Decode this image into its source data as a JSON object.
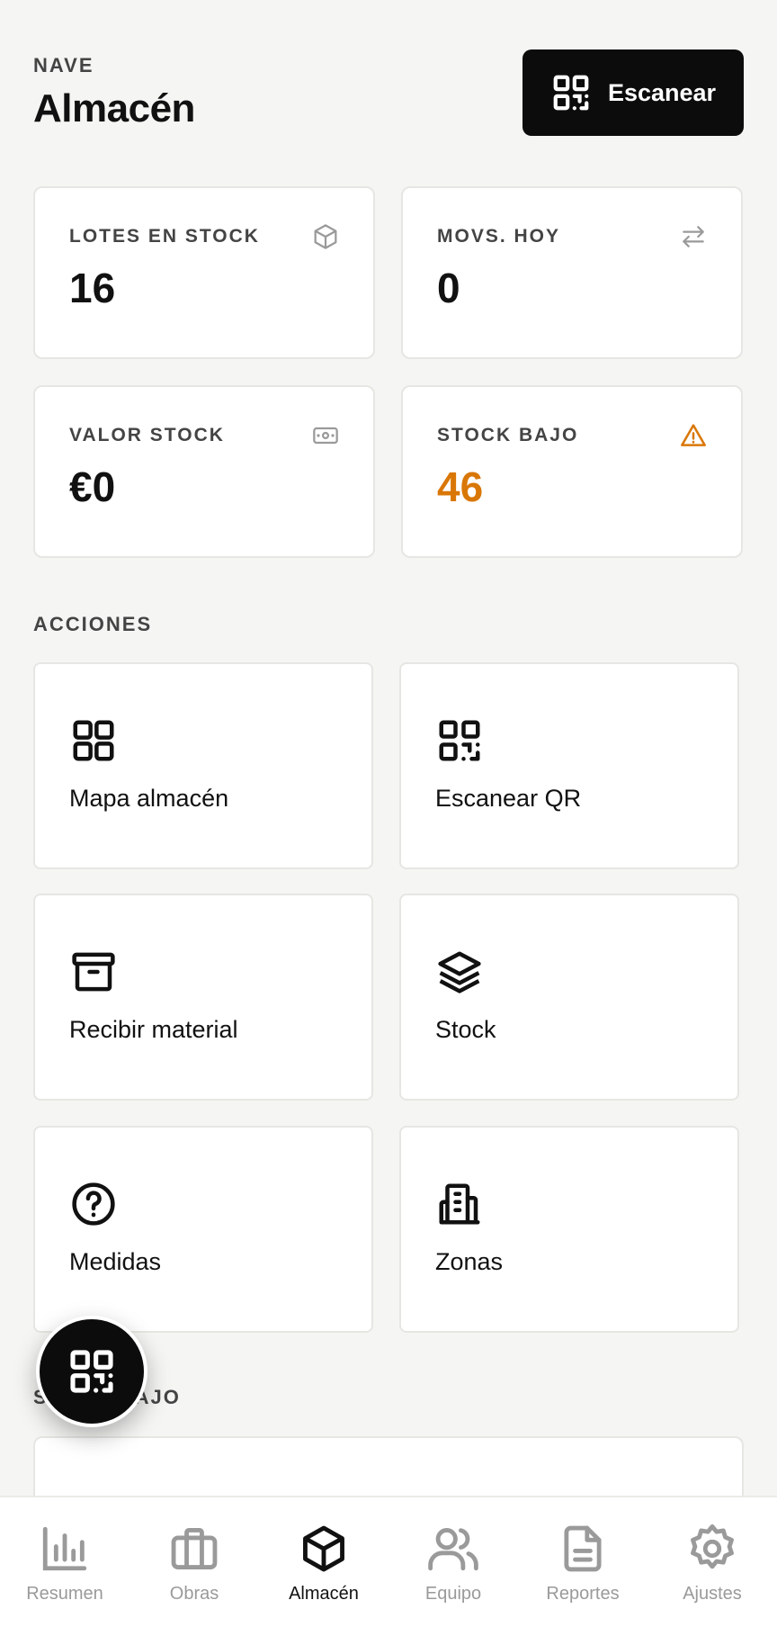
{
  "header": {
    "eyebrow": "NAVE",
    "title": "Almacén",
    "scan_label": "Escanear"
  },
  "stats": [
    {
      "label": "LOTES EN STOCK",
      "value": "16",
      "icon": "cube-icon"
    },
    {
      "label": "MOVS. HOY",
      "value": "0",
      "icon": "arrows-swap-icon"
    },
    {
      "label": "VALOR STOCK",
      "value": "€0",
      "icon": "banknote-icon"
    },
    {
      "label": "STOCK BAJO",
      "value": "46",
      "icon": "warning-triangle-icon",
      "color": "#d97706"
    }
  ],
  "actions_section": {
    "label": "ACCIONES"
  },
  "actions": [
    {
      "label": "Mapa almacén",
      "icon": "grid-icon"
    },
    {
      "label": "Escanear QR",
      "icon": "qr-icon"
    },
    {
      "label": "Recibir material",
      "icon": "archive-box-icon"
    },
    {
      "label": "Stock",
      "icon": "layers-icon"
    },
    {
      "label": "Medidas",
      "icon": "help-circle-icon"
    },
    {
      "label": "Zonas",
      "icon": "building-icon"
    }
  ],
  "low_stock_section": {
    "label": "STOCK BAJO"
  },
  "tabs": [
    {
      "label": "Resumen",
      "icon": "bar-chart-icon",
      "active": false
    },
    {
      "label": "Obras",
      "icon": "briefcase-icon",
      "active": false
    },
    {
      "label": "Almacén",
      "icon": "cube-icon",
      "active": true
    },
    {
      "label": "Equipo",
      "icon": "users-icon",
      "active": false
    },
    {
      "label": "Reportes",
      "icon": "document-icon",
      "active": false
    },
    {
      "label": "Ajustes",
      "icon": "gear-icon",
      "active": false
    }
  ],
  "colors": {
    "accent": "#0c0c0c",
    "warning": "#d97706",
    "background": "#f5f5f3"
  }
}
